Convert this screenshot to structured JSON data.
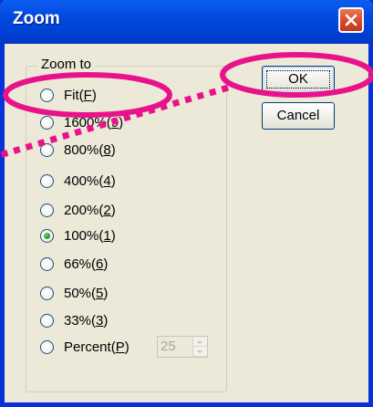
{
  "window": {
    "title": "Zoom",
    "close_icon": "close-icon"
  },
  "group": {
    "label": "Zoom to"
  },
  "options": [
    {
      "label": "Fit",
      "mnemonic": "F",
      "checked": false
    },
    {
      "label": "1600%",
      "mnemonic": "9",
      "checked": false
    },
    {
      "label": "800%",
      "mnemonic": "8",
      "checked": false
    },
    {
      "label": "400%",
      "mnemonic": "4",
      "checked": false
    },
    {
      "label": "200%",
      "mnemonic": "2",
      "checked": false
    },
    {
      "label": "100%",
      "mnemonic": "1",
      "checked": true
    },
    {
      "label": "66%",
      "mnemonic": "6",
      "checked": false
    },
    {
      "label": "50%",
      "mnemonic": "5",
      "checked": false
    },
    {
      "label": "33%",
      "mnemonic": "3",
      "checked": false
    },
    {
      "label": "Percent",
      "mnemonic": "P",
      "checked": false
    }
  ],
  "percent_spinner": {
    "value": "25",
    "enabled": false
  },
  "buttons": {
    "ok": "OK",
    "cancel": "Cancel"
  },
  "annotation": {
    "color": "#e8138a"
  },
  "colors": {
    "title_bar": "#0249de",
    "dialog_background": "#ece9d8",
    "close_button": "#d64a2a",
    "radio_selected": "#21a121"
  }
}
